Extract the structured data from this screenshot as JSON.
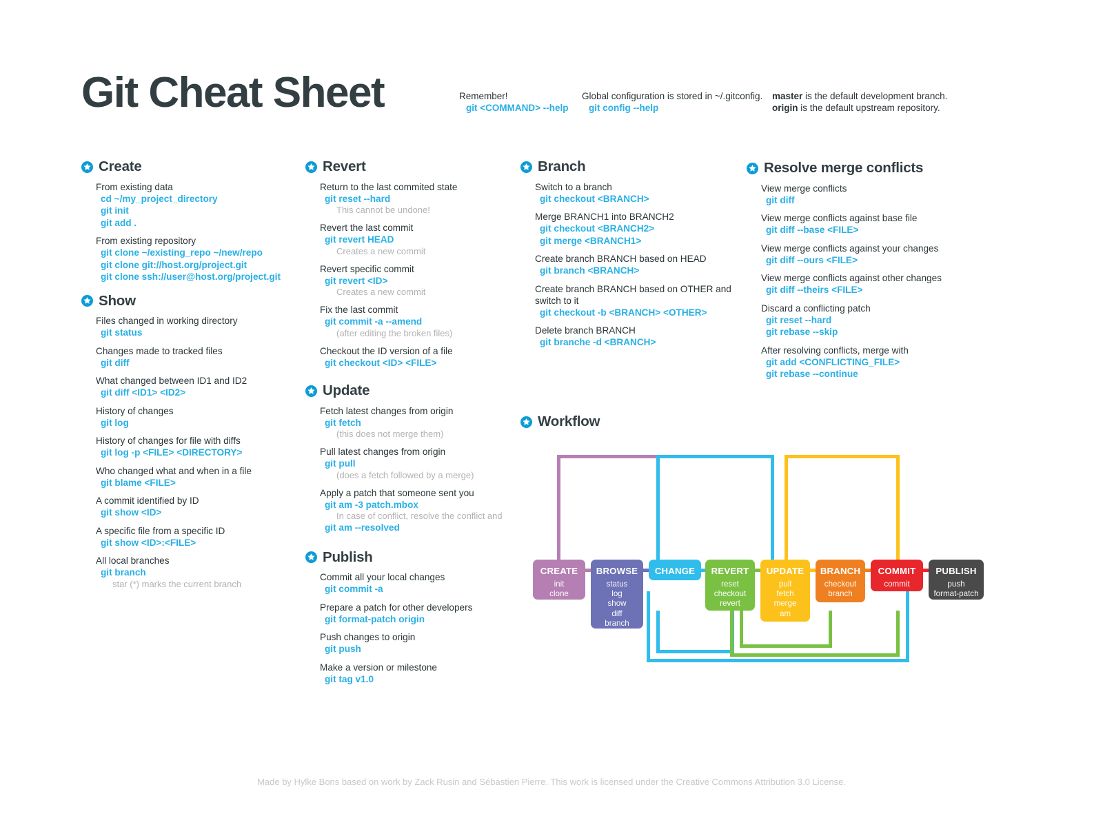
{
  "header": {
    "title": "Git Cheat Sheet",
    "notes": [
      {
        "id": "remember",
        "label": "Remember!",
        "command": "git <COMMAND> --help"
      },
      {
        "id": "config",
        "label": "Global configuration is stored in ~/.gitconfig.",
        "command": "git config --help"
      }
    ],
    "defaults": {
      "line1_bold": "master",
      "line1_rest": " is the default development branch.",
      "line2_bold": "origin",
      "line2_rest": " is the default upstream repository."
    }
  },
  "icons": {
    "section_marker": "star-badge-icon"
  },
  "colors": {
    "accent_command": "#29b0e6",
    "text": "#2b3538",
    "muted": "#b2b2b2",
    "create": "#b57fb3",
    "browse": "#6d71b6",
    "change": "#31bdec",
    "revert": "#7ac143",
    "update": "#fcc21b",
    "branch": "#ef8022",
    "commit": "#e8272c",
    "publish": "#4a4a4a"
  },
  "sections": [
    {
      "id": "create",
      "title": "Create",
      "entries": [
        {
          "desc": "From existing data",
          "cmds": [
            "cd ~/my_project_directory",
            "git init",
            "git add ."
          ],
          "subs": []
        },
        {
          "desc": "From existing repository",
          "cmds": [
            "git clone ~/existing_repo ~/new/repo",
            "git clone git://host.org/project.git",
            "git clone ssh://user@host.org/project.git"
          ],
          "subs": []
        }
      ]
    },
    {
      "id": "show",
      "title": "Show",
      "entries": [
        {
          "desc": "Files changed in working directory",
          "cmds": [
            "git status"
          ],
          "subs": []
        },
        {
          "desc": "Changes made to tracked files",
          "cmds": [
            "git diff"
          ],
          "subs": []
        },
        {
          "desc": "What changed between ID1 and ID2",
          "cmds": [
            "git diff <ID1> <ID2>"
          ],
          "subs": []
        },
        {
          "desc": "History of changes",
          "cmds": [
            "git log"
          ],
          "subs": []
        },
        {
          "desc": "History of changes for file with diffs",
          "cmds": [
            "git log -p <FILE> <DIRECTORY>"
          ],
          "subs": []
        },
        {
          "desc": "Who changed what and when in a file",
          "cmds": [
            "git blame <FILE>"
          ],
          "subs": []
        },
        {
          "desc": "A commit identified by ID",
          "cmds": [
            "git show <ID>"
          ],
          "subs": []
        },
        {
          "desc": "A specific file from a specific ID",
          "cmds": [
            "git show <ID>:<FILE>"
          ],
          "subs": []
        },
        {
          "desc": "All local branches",
          "cmds": [
            "git branch"
          ],
          "subs": [
            "star (*) marks the current branch"
          ]
        }
      ]
    },
    {
      "id": "revert",
      "title": "Revert",
      "entries": [
        {
          "desc": "Return to the last commited state",
          "cmds": [
            "git reset --hard"
          ],
          "subs": [
            "This cannot be undone!"
          ]
        },
        {
          "desc": "Revert the last commit",
          "cmds": [
            "git revert HEAD"
          ],
          "subs": [
            "Creates a new commit"
          ]
        },
        {
          "desc": "Revert specific commit",
          "cmds": [
            "git revert <ID>"
          ],
          "subs": [
            "Creates a new commit"
          ]
        },
        {
          "desc": "Fix the last commit",
          "cmds": [
            "git commit -a --amend"
          ],
          "subs": [
            "(after editing the broken files)"
          ]
        },
        {
          "desc": "Checkout the ID version of a file",
          "cmds": [
            "git checkout <ID> <FILE>"
          ],
          "subs": []
        }
      ]
    },
    {
      "id": "update",
      "title": "Update",
      "entries": [
        {
          "desc": "Fetch latest changes from origin",
          "cmds": [
            "git fetch"
          ],
          "subs": [
            "(this does not merge them)"
          ]
        },
        {
          "desc": "Pull latest changes from origin",
          "cmds": [
            "git pull"
          ],
          "subs": [
            "(does a fetch followed by a merge)"
          ]
        },
        {
          "desc": "Apply a patch that someone sent you",
          "cmds": [
            "git am -3 patch.mbox"
          ],
          "subs": [
            "In case of conflict, resolve the conflict and"
          ],
          "cmds_after": [
            "git am --resolved"
          ]
        }
      ]
    },
    {
      "id": "publish",
      "title": "Publish",
      "entries": [
        {
          "desc": "Commit all your local changes",
          "cmds": [
            "git commit -a"
          ],
          "subs": []
        },
        {
          "desc": "Prepare a patch for other developers",
          "cmds": [
            "git format-patch origin"
          ],
          "subs": []
        },
        {
          "desc": "Push changes to origin",
          "cmds": [
            "git push"
          ],
          "subs": []
        },
        {
          "desc": "Make a version or milestone",
          "cmds": [
            "git tag v1.0"
          ],
          "subs": []
        }
      ]
    },
    {
      "id": "branch",
      "title": "Branch",
      "entries": [
        {
          "desc": "Switch to a branch",
          "cmds": [
            "git checkout <BRANCH>"
          ],
          "subs": []
        },
        {
          "desc": "Merge BRANCH1 into BRANCH2",
          "cmds": [
            "git checkout <BRANCH2>",
            "git merge <BRANCH1>"
          ],
          "subs": []
        },
        {
          "desc": "Create branch BRANCH based on HEAD",
          "cmds": [
            "git branch <BRANCH>"
          ],
          "subs": []
        },
        {
          "desc": "Create branch BRANCH based on OTHER and switch to it",
          "cmds": [
            "git checkout -b <BRANCH> <OTHER>"
          ],
          "subs": []
        },
        {
          "desc": "Delete branch BRANCH",
          "cmds": [
            "git branche -d <BRANCH>"
          ],
          "subs": []
        }
      ]
    },
    {
      "id": "resolve",
      "title": "Resolve merge conflicts",
      "entries": [
        {
          "desc": "View merge conflicts",
          "cmds": [
            "git diff"
          ],
          "subs": []
        },
        {
          "desc": "View merge conflicts against base file",
          "cmds": [
            "git diff --base <FILE>"
          ],
          "subs": []
        },
        {
          "desc": "View merge conflicts against your changes",
          "cmds": [
            "git diff --ours <FILE>"
          ],
          "subs": []
        },
        {
          "desc": "View merge conflicts against other changes",
          "cmds": [
            "git diff --theirs <FILE>"
          ],
          "subs": []
        },
        {
          "desc": "Discard a conflicting patch",
          "cmds": [
            "git reset --hard",
            "git rebase --skip"
          ],
          "subs": []
        },
        {
          "desc": "After resolving conflicts, merge with",
          "cmds": [
            "git add <CONFLICTING_FILE>",
            "git rebase --continue"
          ],
          "subs": []
        }
      ]
    }
  ],
  "workflow": {
    "title": "Workflow",
    "boxes": [
      {
        "id": "create",
        "label": "CREATE",
        "cmds": [
          "init",
          "clone"
        ],
        "color": "#b57fb3"
      },
      {
        "id": "browse",
        "label": "BROWSE",
        "cmds": [
          "status",
          "log",
          "show",
          "diff",
          "branch"
        ],
        "color": "#6d71b6"
      },
      {
        "id": "change",
        "label": "CHANGE",
        "cmds": [],
        "color": "#31bdec"
      },
      {
        "id": "revert",
        "label": "REVERT",
        "cmds": [
          "reset",
          "checkout",
          "revert"
        ],
        "color": "#7ac143"
      },
      {
        "id": "update",
        "label": "UPDATE",
        "cmds": [
          "pull",
          "fetch",
          "merge",
          "am"
        ],
        "color": "#fcc21b"
      },
      {
        "id": "branch",
        "label": "BRANCH",
        "cmds": [
          "checkout",
          "branch"
        ],
        "color": "#ef8022"
      },
      {
        "id": "commit",
        "label": "COMMIT",
        "cmds": [
          "commit"
        ],
        "color": "#e8272c"
      },
      {
        "id": "publish",
        "label": "PUBLISH",
        "cmds": [
          "push",
          "format-patch"
        ],
        "color": "#4a4a4a"
      }
    ]
  },
  "footer": {
    "text": "Made by Hylke Bons based on work by Zack Rusin and Sébastien Pierre. This work is licensed under the Creative Commons Attribution 3.0 License."
  }
}
